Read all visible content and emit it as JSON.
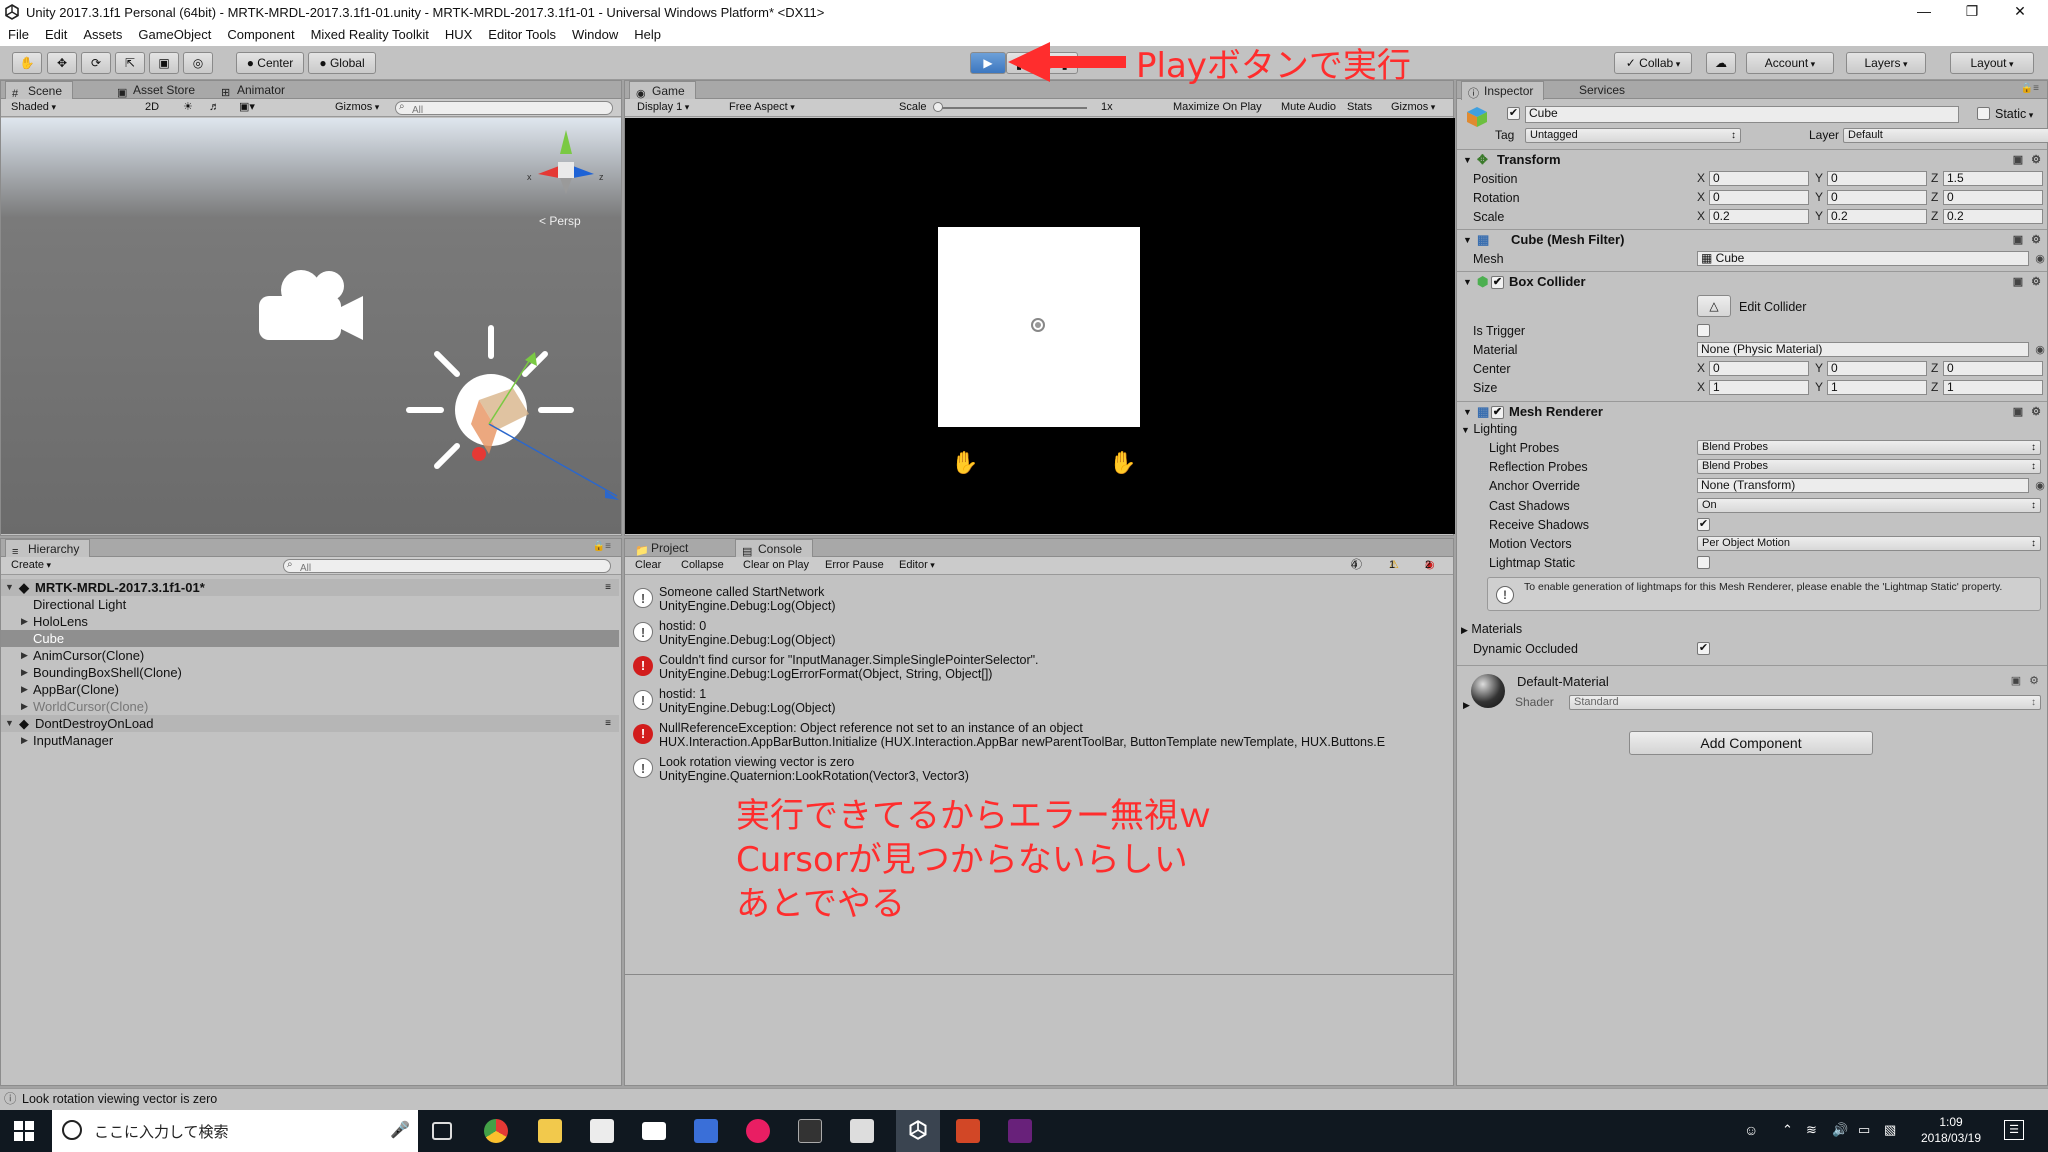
{
  "window": {
    "title": "Unity 2017.3.1f1 Personal (64bit) - MRTK-MRDL-2017.3.1f1-01.unity - MRTK-MRDL-2017.3.1f1-01 - Universal Windows Platform* <DX11>"
  },
  "menu": [
    "File",
    "Edit",
    "Assets",
    "GameObject",
    "Component",
    "Mixed Reality Toolkit",
    "HUX",
    "Editor Tools",
    "Window",
    "Help"
  ],
  "toolbar": {
    "pivot": "Center",
    "space": "Global",
    "collab": "Collab",
    "account": "Account",
    "layers": "Layers",
    "layout": "Layout"
  },
  "scene": {
    "tabs": [
      "Scene",
      "Asset Store",
      "Animator"
    ],
    "shading": "Shaded",
    "mode2d": "2D",
    "gizmos": "Gizmos",
    "search": "All",
    "persp": "Persp"
  },
  "game": {
    "tab": "Game",
    "display": "Display 1",
    "aspect": "Free Aspect",
    "scale_label": "Scale",
    "scale_value": "1x",
    "maximize": "Maximize On Play",
    "mute": "Mute Audio",
    "stats": "Stats",
    "gizmos": "Gizmos"
  },
  "hierarchy": {
    "tab": "Hierarchy",
    "create": "Create",
    "search": "All",
    "scene_name": "MRTK-MRDL-2017.3.1f1-01*",
    "items": [
      {
        "label": "Directional Light",
        "indent": 1,
        "arrow": false,
        "dim": false,
        "selected": false
      },
      {
        "label": "HoloLens",
        "indent": 1,
        "arrow": true,
        "dim": false,
        "selected": false
      },
      {
        "label": "Cube",
        "indent": 1,
        "arrow": false,
        "dim": false,
        "selected": true
      },
      {
        "label": "AnimCursor(Clone)",
        "indent": 1,
        "arrow": true,
        "dim": false,
        "selected": false
      },
      {
        "label": "BoundingBoxShell(Clone)",
        "indent": 1,
        "arrow": true,
        "dim": false,
        "selected": false
      },
      {
        "label": "AppBar(Clone)",
        "indent": 1,
        "arrow": true,
        "dim": false,
        "selected": false
      },
      {
        "label": "WorldCursor(Clone)",
        "indent": 1,
        "arrow": true,
        "dim": true,
        "selected": false
      }
    ],
    "dont_destroy": "DontDestroyOnLoad",
    "dont_destroy_items": [
      "InputManager"
    ]
  },
  "console": {
    "tabs": [
      "Project",
      "Console"
    ],
    "buttons": [
      "Clear",
      "Collapse",
      "Clear on Play",
      "Error Pause",
      "Editor"
    ],
    "counts": {
      "info": "4",
      "warn": "1",
      "error": "2"
    },
    "entries": [
      {
        "type": "info",
        "line1": "Someone called StartNetwork",
        "line2": "UnityEngine.Debug:Log(Object)"
      },
      {
        "type": "info",
        "line1": "hostid: 0",
        "line2": "UnityEngine.Debug:Log(Object)"
      },
      {
        "type": "error",
        "line1": "Couldn't find cursor for \"InputManager.SimpleSinglePointerSelector\".",
        "line2": "UnityEngine.Debug:LogErrorFormat(Object, String, Object[])"
      },
      {
        "type": "info",
        "line1": "hostid: 1",
        "line2": "UnityEngine.Debug:Log(Object)"
      },
      {
        "type": "error",
        "line1": "NullReferenceException: Object reference not set to an instance of an object",
        "line2": "HUX.Interaction.AppBarButton.Initialize (HUX.Interaction.AppBar newParentToolBar, ButtonTemplate newTemplate, HUX.Buttons.E"
      },
      {
        "type": "info",
        "line1": "Look rotation viewing vector is zero",
        "line2": "UnityEngine.Quaternion:LookRotation(Vector3, Vector3)"
      }
    ]
  },
  "inspector": {
    "tabs": [
      "Inspector",
      "Services"
    ],
    "object_name": "Cube",
    "static_label": "Static",
    "tag_label": "Tag",
    "tag_value": "Untagged",
    "layer_label": "Layer",
    "layer_value": "Default",
    "transform": {
      "title": "Transform",
      "rows": [
        {
          "label": "Position",
          "x": "0",
          "y": "0",
          "z": "1.5"
        },
        {
          "label": "Rotation",
          "x": "0",
          "y": "0",
          "z": "0"
        },
        {
          "label": "Scale",
          "x": "0.2",
          "y": "0.2",
          "z": "0.2"
        }
      ]
    },
    "mesh_filter": {
      "title": "Cube (Mesh Filter)",
      "mesh_label": "Mesh",
      "mesh_value": "Cube"
    },
    "box_collider": {
      "title": "Box Collider",
      "edit": "Edit Collider",
      "is_trigger": "Is Trigger",
      "material_label": "Material",
      "material_value": "None (Physic Material)",
      "center": {
        "label": "Center",
        "x": "0",
        "y": "0",
        "z": "0"
      },
      "size": {
        "label": "Size",
        "x": "1",
        "y": "1",
        "z": "1"
      }
    },
    "mesh_renderer": {
      "title": "Mesh Renderer",
      "lighting": "Lighting",
      "light_probes_label": "Light Probes",
      "light_probes_value": "Blend Probes",
      "reflection_probes_label": "Reflection Probes",
      "reflection_probes_value": "Blend Probes",
      "anchor_label": "Anchor Override",
      "anchor_value": "None (Transform)",
      "cast_label": "Cast Shadows",
      "cast_value": "On",
      "receive_label": "Receive Shadows",
      "motion_label": "Motion Vectors",
      "motion_value": "Per Object Motion",
      "lightmap_label": "Lightmap Static",
      "help": "To enable generation of lightmaps for this Mesh Renderer, please enable the 'Lightmap Static' property.",
      "materials": "Materials",
      "dynamic_occluded": "Dynamic Occluded"
    },
    "material": {
      "name": "Default-Material",
      "shader_label": "Shader",
      "shader_value": "Standard"
    },
    "add_component": "Add Component"
  },
  "status": "Look rotation viewing vector is zero",
  "taskbar": {
    "search": "ここに入力して検索",
    "time": "1:09",
    "date": "2018/03/19"
  },
  "annotations": {
    "play": "Playボタンで実行",
    "note1": "実行できてるからエラー無視ｗ",
    "note2": "Cursorが見つからないらしい",
    "note3": "あとでやる"
  },
  "colors": {
    "annotation": "#ff2d2d",
    "error": "#d21c1c",
    "selection": "#8f8f8f"
  }
}
